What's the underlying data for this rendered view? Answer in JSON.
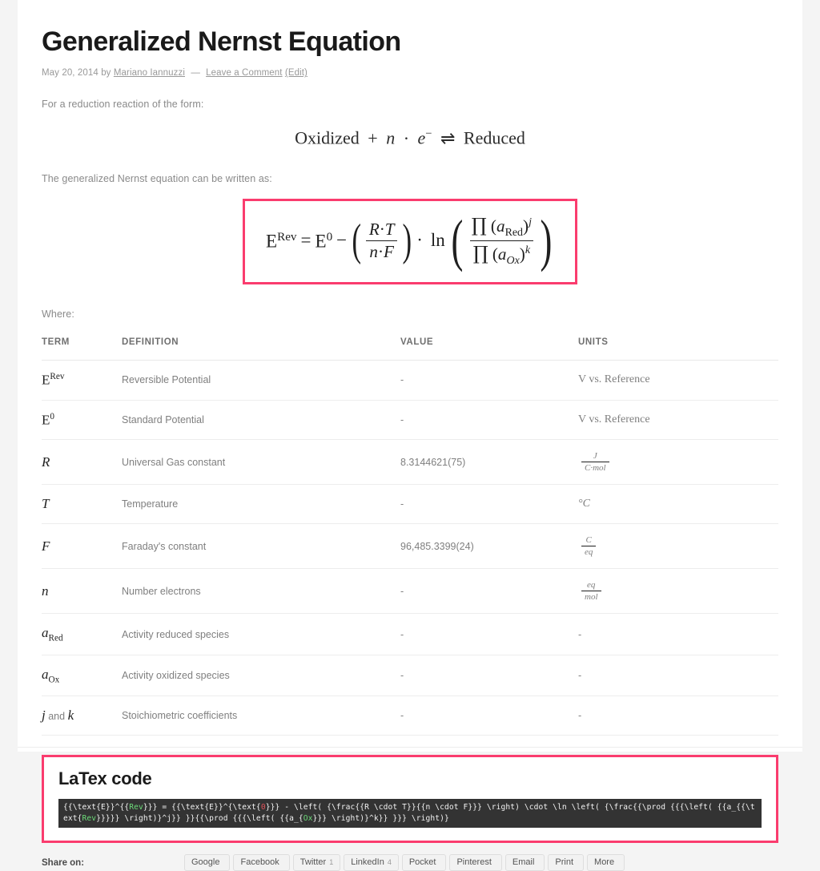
{
  "post": {
    "title": "Generalized Nernst Equation",
    "meta": {
      "date": "May 20, 2014",
      "by": "by",
      "author": "Mariano Iannuzzi",
      "dash": "—",
      "comment_link": "Leave a Comment",
      "edit_link": "(Edit)"
    },
    "intro_1": "For a reduction reaction of the form:",
    "intro_2": "The generalized Nernst equation can be written as:",
    "where_label": "Where:"
  },
  "reaction_equation": {
    "oxidized": "Oxidized",
    "plus": "+",
    "n": "n",
    "cdot": "·",
    "e": "e",
    "e_charge": "−",
    "equilibrium": "⇌",
    "reduced": "Reduced"
  },
  "nernst_equation": {
    "E": "E",
    "Rev": "Rev",
    "equals": "=",
    "zero": "0",
    "minus": "−",
    "R": "R",
    "T": "T",
    "n": "n",
    "F": "F",
    "cdot": "·",
    "ln": "ln",
    "prod": "∏",
    "a": "a",
    "Red": "Red",
    "Ox": "Ox",
    "j": "j",
    "k": "k",
    "border_color": "#fa3c6e"
  },
  "table": {
    "headers": [
      "TERM",
      "DEFINITION",
      "VALUE",
      "UNITS"
    ],
    "rows": [
      {
        "definition": "Reversible Potential",
        "value": "-",
        "units": "V vs.  Reference"
      },
      {
        "definition": "Standard Potential",
        "value": "-",
        "units": "V vs.  Reference"
      },
      {
        "definition": "Universal Gas constant",
        "value": "8.3144621(75)",
        "units_num": "J",
        "units_den": "C·mol"
      },
      {
        "definition": "Temperature",
        "value": "-",
        "units": "°C"
      },
      {
        "definition": "Faraday's constant",
        "value": "96,485.3399(24)",
        "units_num": "C",
        "units_den": "eq"
      },
      {
        "definition": "Number electrons",
        "value": "-",
        "units_num": "eq",
        "units_den": "mol"
      },
      {
        "definition": "Activity reduced species",
        "value": "-",
        "units": "-"
      },
      {
        "definition": "Activity oxidized species",
        "value": "-",
        "units": "-"
      },
      {
        "definition": "Stoichiometric coefficients",
        "value": "-",
        "units": "-"
      }
    ],
    "term_and": "and"
  },
  "latex": {
    "heading": "LaTex code",
    "line1_a": "{{\\text{E}}^{{",
    "line1_rev": "Rev",
    "line1_b": "}}} = {{\\text{E}}^{\\text{",
    "line1_zero": "0",
    "line1_c": "}}} - \\left( {\\frac{{R \\cdot T}}{{n \\cdot F}}} \\right) \\cdot \\ln \\left( {\\frac{{\\prod {{{\\left( {{a_{{\\text{",
    "line2_rev": "Rev",
    "line2_a": "}}}}} \\right)}^j}} }}{{\\prod {{{\\left( {{a_{",
    "line2_ox": "Ox",
    "line2_b": "}}} \\right)}^k}} }}} \\right)}",
    "border_color": "#fa3c6e",
    "bg": "#333333"
  },
  "share": {
    "label": "Share on:",
    "buttons": [
      {
        "label": "Google",
        "count": ""
      },
      {
        "label": "Facebook",
        "count": ""
      },
      {
        "label": "Twitter",
        "count": "1"
      },
      {
        "label": "LinkedIn",
        "count": "4"
      },
      {
        "label": "Pocket",
        "count": ""
      },
      {
        "label": "Pinterest",
        "count": ""
      },
      {
        "label": "Email",
        "count": ""
      },
      {
        "label": "Print",
        "count": ""
      },
      {
        "label": "More",
        "count": ""
      }
    ]
  }
}
